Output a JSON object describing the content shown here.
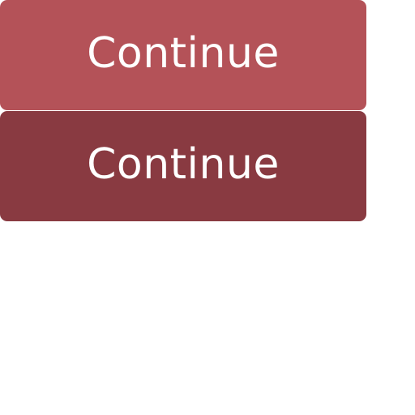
{
  "buttons": [
    {
      "label": "Continue",
      "state": "normal",
      "color": "#b45258"
    },
    {
      "label": "Continue",
      "state": "pressed",
      "color": "#893a41"
    }
  ]
}
